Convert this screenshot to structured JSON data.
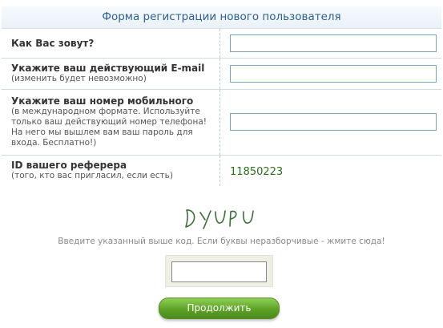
{
  "form": {
    "title": "Форма регистрации нового пользователя",
    "fields": [
      {
        "label": "Как Вас зовут?",
        "hint": "",
        "value": ""
      },
      {
        "label": "Укажите ваш действующий E-mail",
        "hint": "(изменить будет невозможно)",
        "value": ""
      },
      {
        "label": "Укажите ваш номер мобильного",
        "hint": "(в международном формате. Используйте только ваш действующий номер телефона! На него мы вышлем вам ваш пароль для входа. Бесплатно!)",
        "value": ""
      },
      {
        "label": "ID вашего реферера",
        "hint": "(того, кто вас пригласил, если есть)",
        "value": "11850223"
      }
    ]
  },
  "captcha": {
    "image_text": "DYUPU",
    "hint": "Введите указанный выше код. Если буквы неразборчивые - жмите сюда!",
    "value": ""
  },
  "submit": {
    "label": "Продолжить"
  },
  "colors": {
    "header_text": "#2f5f8f",
    "referrer_text": "#2e6b1f",
    "button": "#5da127",
    "captcha_ink": "#3f6e3a"
  }
}
